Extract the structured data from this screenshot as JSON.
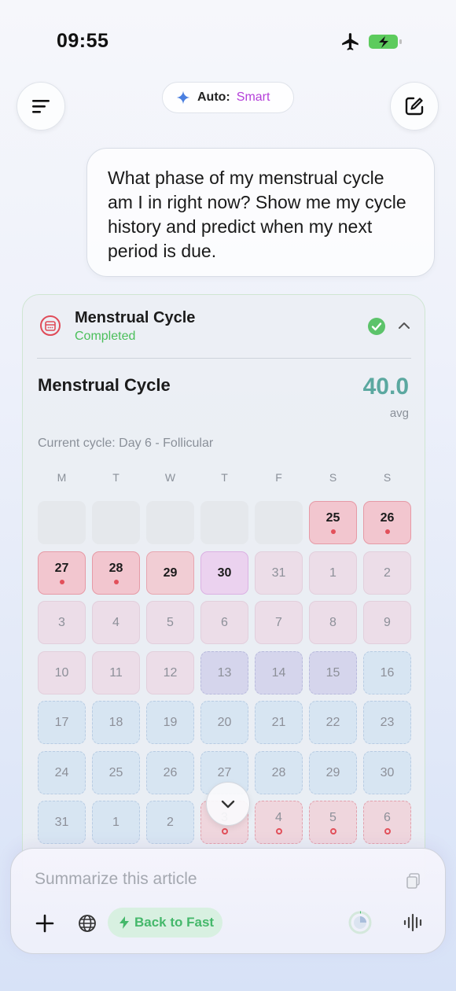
{
  "status_bar": {
    "time": "09:55",
    "icons": [
      "airplane-icon",
      "battery-charging-icon"
    ],
    "battery_color": "#5dcb5d"
  },
  "header": {
    "menu_icon": "hamburger-menu-icon",
    "compose_icon": "compose-icon",
    "model": {
      "auto_label": "Auto:",
      "mode_label": "Smart",
      "icon": "sparkle-icon"
    }
  },
  "chat": {
    "user_message": "What phase of my menstrual cycle am I in right now? Show me my cycle history and predict when my next period is due."
  },
  "tool_card": {
    "title": "Menstrual Cycle",
    "status": "Completed",
    "status_color": "#4bbf5a",
    "section_title": "Menstrual Cycle",
    "avg_value": "40.0",
    "avg_label": "avg",
    "cycle_info": "Current cycle: Day 6 - Follicular",
    "weekdays": [
      "M",
      "T",
      "W",
      "T",
      "F",
      "S",
      "S"
    ],
    "calendar": [
      [
        {
          "t": "",
          "k": "empty"
        },
        {
          "t": "",
          "k": "empty"
        },
        {
          "t": "",
          "k": "empty"
        },
        {
          "t": "",
          "k": "empty"
        },
        {
          "t": "",
          "k": "empty"
        },
        {
          "t": "25",
          "k": "period",
          "m": "dot"
        },
        {
          "t": "26",
          "k": "period",
          "m": "dot"
        }
      ],
      [
        {
          "t": "27",
          "k": "period",
          "m": "dot"
        },
        {
          "t": "28",
          "k": "period",
          "m": "dot"
        },
        {
          "t": "29",
          "k": "period-light"
        },
        {
          "t": "30",
          "k": "ovul"
        },
        {
          "t": "31",
          "k": "pink"
        },
        {
          "t": "1",
          "k": "pink"
        },
        {
          "t": "2",
          "k": "pink"
        }
      ],
      [
        {
          "t": "3",
          "k": "pink"
        },
        {
          "t": "4",
          "k": "pink"
        },
        {
          "t": "5",
          "k": "pink"
        },
        {
          "t": "6",
          "k": "pink"
        },
        {
          "t": "7",
          "k": "pink"
        },
        {
          "t": "8",
          "k": "pink"
        },
        {
          "t": "9",
          "k": "pink"
        }
      ],
      [
        {
          "t": "10",
          "k": "pink"
        },
        {
          "t": "11",
          "k": "pink"
        },
        {
          "t": "12",
          "k": "pink"
        },
        {
          "t": "13",
          "k": "purple"
        },
        {
          "t": "14",
          "k": "purple"
        },
        {
          "t": "15",
          "k": "purple"
        },
        {
          "t": "16",
          "k": "blue"
        }
      ],
      [
        {
          "t": "17",
          "k": "blue"
        },
        {
          "t": "18",
          "k": "blue"
        },
        {
          "t": "19",
          "k": "blue"
        },
        {
          "t": "20",
          "k": "blue"
        },
        {
          "t": "21",
          "k": "blue"
        },
        {
          "t": "22",
          "k": "blue"
        },
        {
          "t": "23",
          "k": "blue"
        }
      ],
      [
        {
          "t": "24",
          "k": "blue"
        },
        {
          "t": "25",
          "k": "blue"
        },
        {
          "t": "26",
          "k": "blue"
        },
        {
          "t": "27",
          "k": "blue"
        },
        {
          "t": "28",
          "k": "blue"
        },
        {
          "t": "29",
          "k": "blue"
        },
        {
          "t": "30",
          "k": "blue"
        }
      ],
      [
        {
          "t": "31",
          "k": "blue"
        },
        {
          "t": "1",
          "k": "blue"
        },
        {
          "t": "2",
          "k": "blue"
        },
        {
          "t": "3",
          "k": "pred",
          "m": "ring"
        },
        {
          "t": "4",
          "k": "pred",
          "m": "ring"
        },
        {
          "t": "5",
          "k": "pred",
          "m": "ring"
        },
        {
          "t": "6",
          "k": "pred",
          "m": "ring"
        }
      ]
    ]
  },
  "composer": {
    "placeholder": "Summarize this article",
    "fast_label": "Back to Fast",
    "icons": [
      "clipboard-icon",
      "plus-icon",
      "globe-icon",
      "lightning-icon",
      "usage-ring-icon",
      "voice-waveform-icon"
    ],
    "accent": "#45b86b"
  }
}
